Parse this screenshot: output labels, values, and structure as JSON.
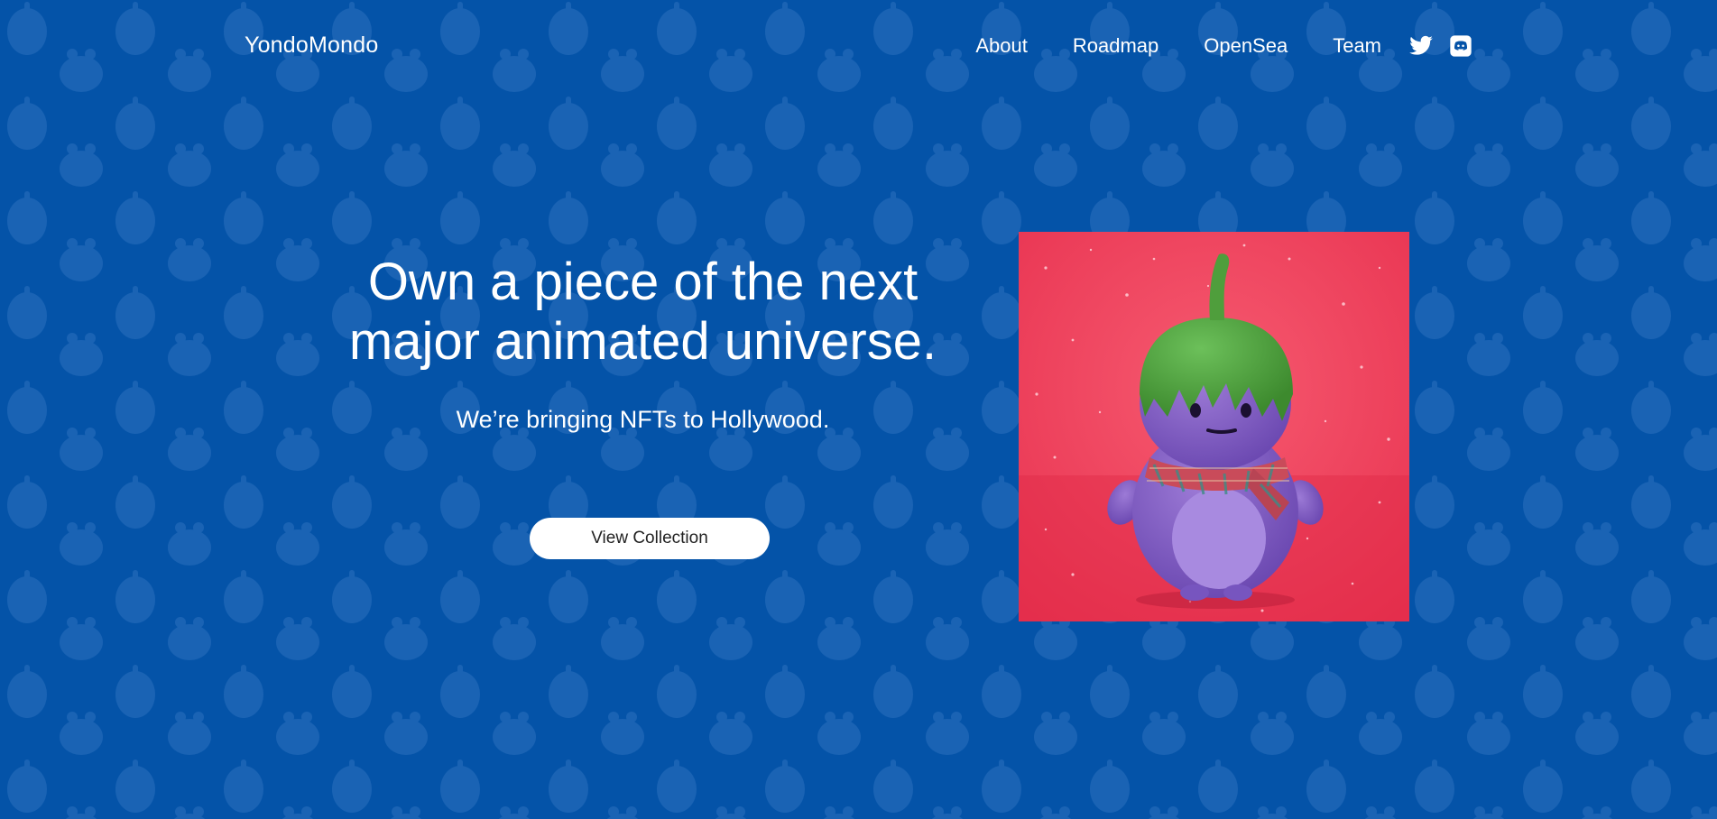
{
  "brand": {
    "name": "YondoMondo"
  },
  "nav": {
    "links": [
      {
        "label": "About"
      },
      {
        "label": "Roadmap"
      },
      {
        "label": "OpenSea"
      },
      {
        "label": "Team"
      }
    ],
    "social": [
      {
        "icon": "twitter-icon"
      },
      {
        "icon": "discord-icon"
      }
    ]
  },
  "hero": {
    "title_line1": "Own a piece of the next",
    "title_line2": "major animated universe.",
    "subtitle": "We’re bringing NFTs to Hollywood.",
    "cta_label": "View Collection"
  },
  "colors": {
    "background": "#0453a8",
    "pattern": "#1a63b4",
    "artwork_bg": "#f2445f",
    "character_body": "#8a63c8",
    "character_hat": "#4f9e3c"
  }
}
